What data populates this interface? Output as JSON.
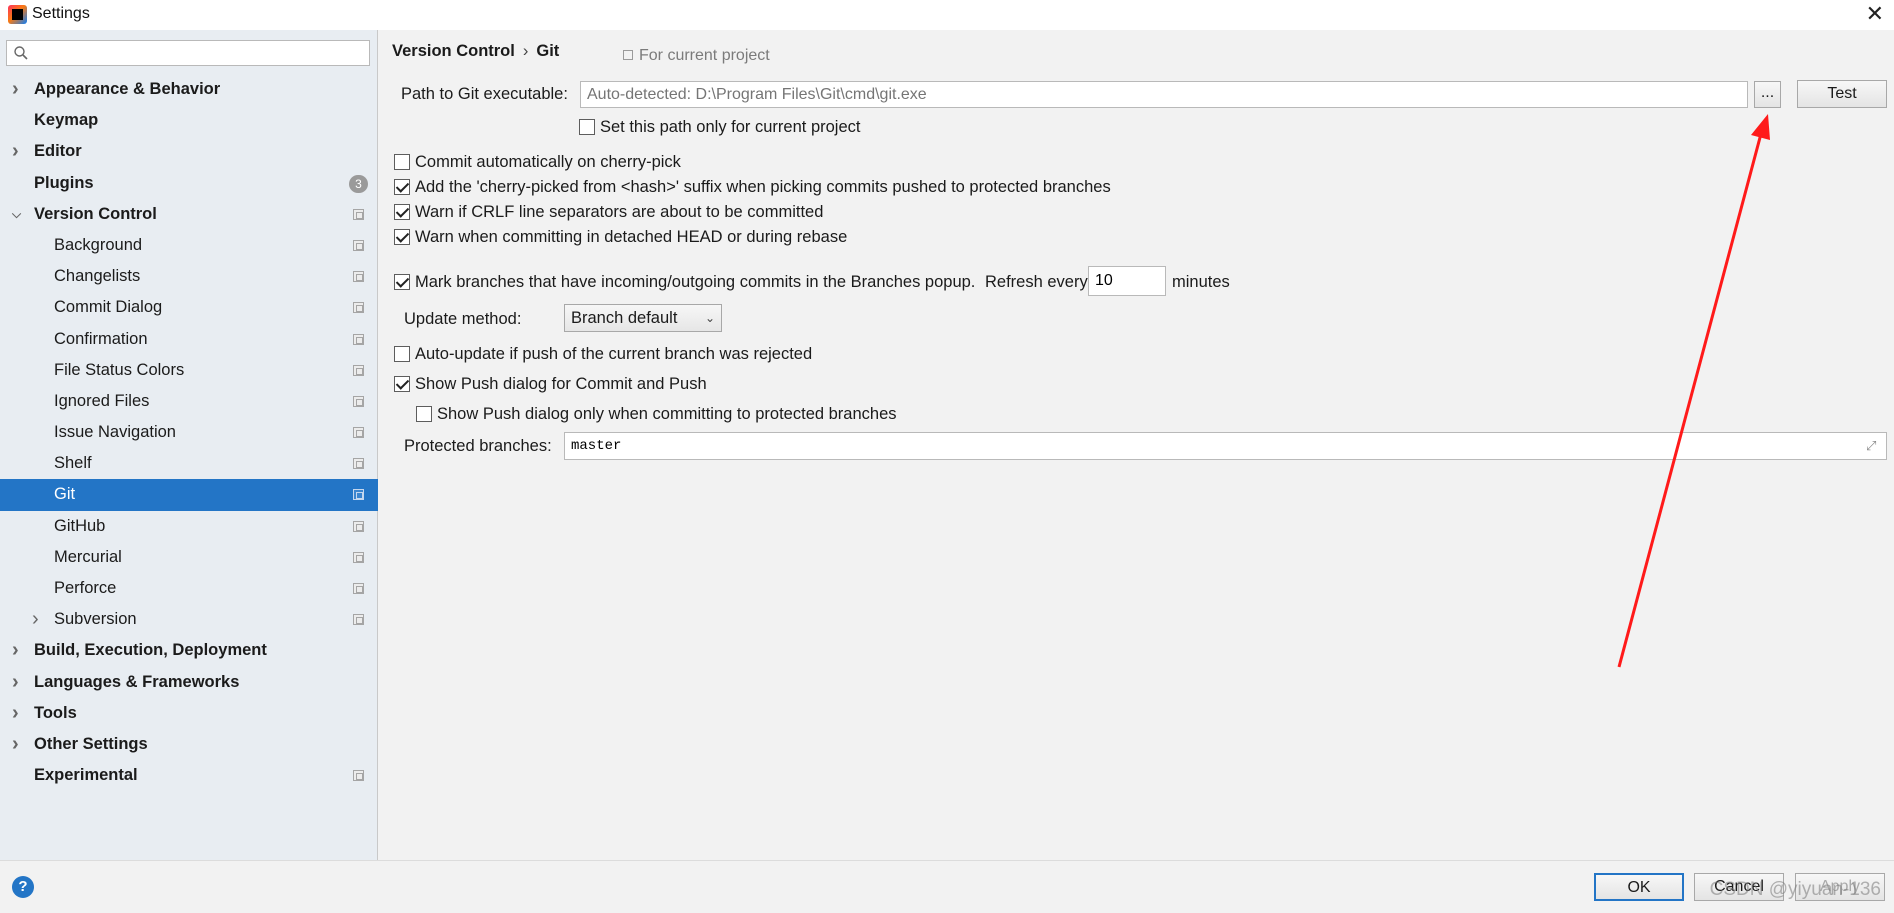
{
  "window": {
    "title": "Settings"
  },
  "search": {
    "placeholder": ""
  },
  "sidebar": {
    "items": [
      {
        "label": "Appearance & Behavior",
        "level": 0,
        "expandable": true,
        "expanded": false
      },
      {
        "label": "Keymap",
        "level": 0
      },
      {
        "label": "Editor",
        "level": 0,
        "expandable": true,
        "expanded": false
      },
      {
        "label": "Plugins",
        "level": 0,
        "badge": "3"
      },
      {
        "label": "Version Control",
        "level": 0,
        "expandable": true,
        "expanded": true
      },
      {
        "label": "Background",
        "level": 1
      },
      {
        "label": "Changelists",
        "level": 1
      },
      {
        "label": "Commit Dialog",
        "level": 1
      },
      {
        "label": "Confirmation",
        "level": 1
      },
      {
        "label": "File Status Colors",
        "level": 1
      },
      {
        "label": "Ignored Files",
        "level": 1
      },
      {
        "label": "Issue Navigation",
        "level": 1
      },
      {
        "label": "Shelf",
        "level": 1
      },
      {
        "label": "Git",
        "level": 1,
        "selected": true
      },
      {
        "label": "GitHub",
        "level": 1
      },
      {
        "label": "Mercurial",
        "level": 1
      },
      {
        "label": "Perforce",
        "level": 1
      },
      {
        "label": "Subversion",
        "level": 1,
        "expandable": true
      },
      {
        "label": "Build, Execution, Deployment",
        "level": 0,
        "expandable": true
      },
      {
        "label": "Languages & Frameworks",
        "level": 0,
        "expandable": true
      },
      {
        "label": "Tools",
        "level": 0,
        "expandable": true
      },
      {
        "label": "Other Settings",
        "level": 0,
        "expandable": true
      },
      {
        "label": "Experimental",
        "level": 0
      }
    ]
  },
  "breadcrumb": {
    "parent": "Version Control",
    "separator": "›",
    "current": "Git",
    "scope_note": "For current project"
  },
  "git": {
    "path_label": "Path to Git executable:",
    "path_placeholder": "Auto-detected: D:\\Program Files\\Git\\cmd\\git.exe",
    "browse_label": "...",
    "test_label": "Test",
    "set_path_only": {
      "label": "Set this path only for current project",
      "checked": false
    },
    "options": [
      {
        "label": "Commit automatically on cherry-pick",
        "checked": false
      },
      {
        "label": "Add the 'cherry-picked from <hash>' suffix when picking commits pushed to protected branches",
        "checked": true
      },
      {
        "label": "Warn if CRLF line separators are about to be committed",
        "checked": true
      },
      {
        "label": "Warn when committing in detached HEAD or during rebase",
        "checked": true
      }
    ],
    "mark_branches": {
      "label": "Mark branches that have incoming/outgoing commits in the Branches popup.",
      "checked": true
    },
    "refresh_label": "Refresh every",
    "refresh_value": "10",
    "minutes_label": "minutes",
    "update_method_label": "Update method:",
    "update_method_value": "Branch default",
    "auto_update": {
      "label": "Auto-update if push of the current branch was rejected",
      "checked": false
    },
    "show_push": {
      "label": "Show Push dialog for Commit and Push",
      "checked": true
    },
    "show_push_protected": {
      "label": "Show Push dialog only when committing to protected branches",
      "checked": false
    },
    "protected_label": "Protected branches:",
    "protected_value": "master"
  },
  "footer": {
    "help": "?",
    "ok_label": "OK",
    "cancel_label": "Cancel",
    "apply_label": "Apply",
    "watermark": "CSDN @yiyuan-136"
  },
  "colors": {
    "selection": "#2375c6",
    "annotation_arrow": "#ff1a1a",
    "sidebar_bg": "#e8edf2"
  }
}
